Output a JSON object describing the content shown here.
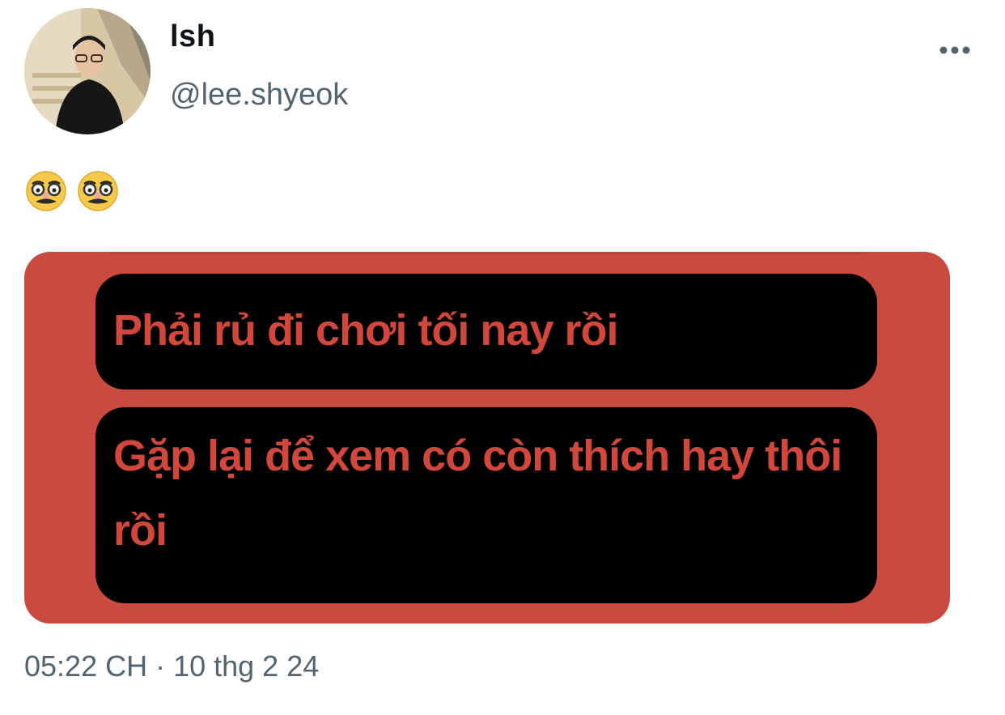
{
  "tweet": {
    "author": {
      "display_name": "lsh",
      "handle": "@lee.shyeok",
      "avatar_icon": "profile-photo"
    },
    "more_icon": "more-dots-icon",
    "text_emojis": [
      "disguised-face-emoji",
      "disguised-face-emoji"
    ],
    "media": {
      "background_color": "#c94a3e",
      "text_color": "#d2473c",
      "bubble_color": "#000000",
      "messages": [
        "Phải rủ đi chơi tối nay rồi",
        "Gặp lại để xem có còn thích hay thôi rồi"
      ]
    },
    "timestamp": "05:22 CH · 10 thg 2 24"
  }
}
